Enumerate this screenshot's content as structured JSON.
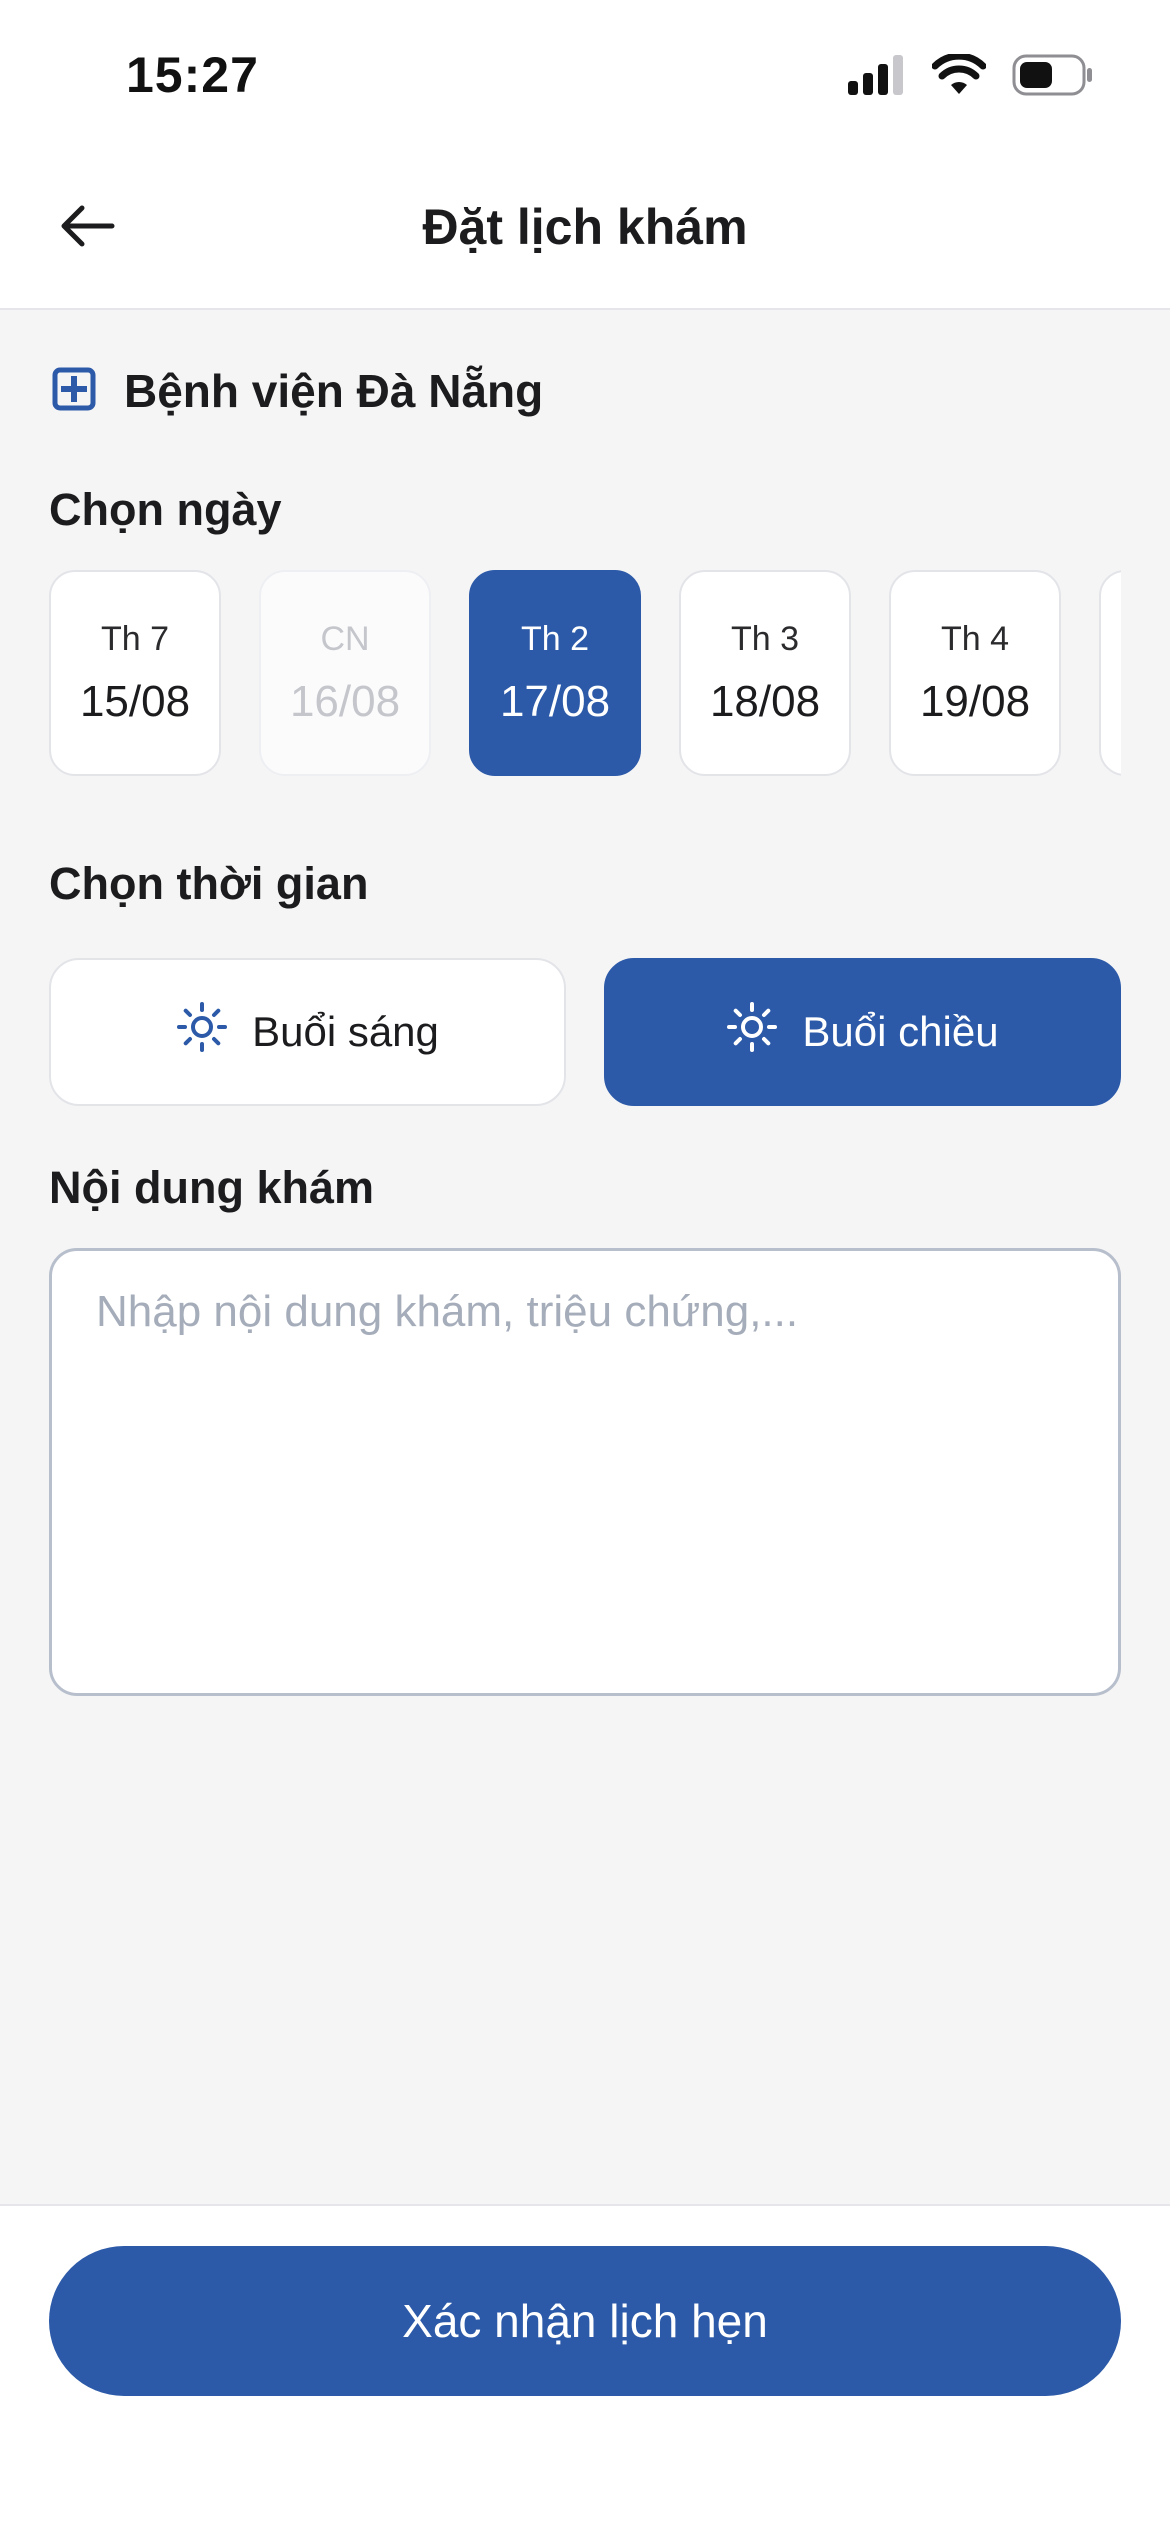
{
  "status_bar": {
    "time": "15:27",
    "icons": [
      "cellular-signal-icon",
      "wifi-icon",
      "battery-icon"
    ]
  },
  "header": {
    "title": "Đặt lịch khám",
    "back_icon": "arrow-left-icon"
  },
  "hospital": {
    "name": "Bệnh viện Đà Nẵng",
    "icon": "hospital-plus-icon"
  },
  "date_section": {
    "label": "Chọn ngày",
    "dates": [
      {
        "day": "Th 7",
        "date": "15/08",
        "state": "available"
      },
      {
        "day": "CN",
        "date": "16/08",
        "state": "disabled"
      },
      {
        "day": "Th 2",
        "date": "17/08",
        "state": "selected"
      },
      {
        "day": "Th 3",
        "date": "18/08",
        "state": "available"
      },
      {
        "day": "Th 4",
        "date": "19/08",
        "state": "available"
      }
    ]
  },
  "time_section": {
    "label": "Chọn thời gian",
    "options": [
      {
        "label": "Buổi sáng",
        "icon": "sun-icon",
        "selected": false
      },
      {
        "label": "Buổi chiều",
        "icon": "sun-icon",
        "selected": true
      }
    ]
  },
  "content_section": {
    "label": "Nội dung khám",
    "placeholder": "Nhập nội dung khám, triệu chứng,...",
    "value": ""
  },
  "footer": {
    "confirm_label": "Xác nhận lịch hẹn"
  },
  "colors": {
    "primary": "#2c5aa8",
    "background": "#f5f5f6",
    "surface": "#ffffff",
    "disabled_text": "#c4c6cc",
    "placeholder": "#a6adba"
  }
}
